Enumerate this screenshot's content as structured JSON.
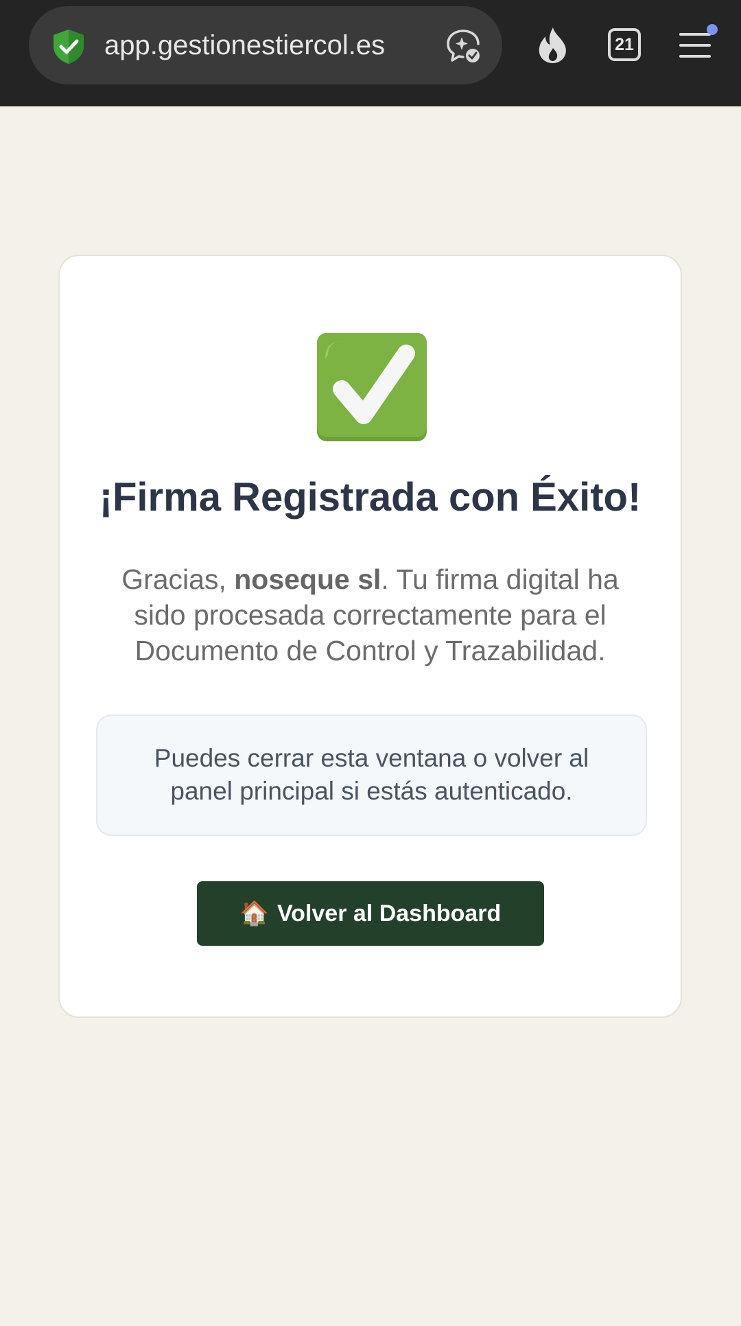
{
  "browser": {
    "url": "app.gestionestiercol.es",
    "tab_count": "21",
    "icons": [
      "shield-check-icon",
      "ai-assistant-icon",
      "fire-icon",
      "tabs-icon",
      "menu-icon"
    ]
  },
  "card": {
    "title": "¡Firma Registrada con Éxito!",
    "message_prefix": "Gracias, ",
    "message_name": "noseque sl",
    "message_suffix": ". Tu firma digital ha sido procesada correctamente para el Documento de Control y Trazabilidad.",
    "info": "Puedes cerrar esta ventana o volver al panel principal si estás autenticado.",
    "button_label": "Volver al Dashboard",
    "button_emoji": "🏠"
  },
  "colors": {
    "page_bg": "#f4f1eb",
    "button_bg": "#22402a",
    "title": "#2d3548",
    "check_green": "#7cb342"
  }
}
